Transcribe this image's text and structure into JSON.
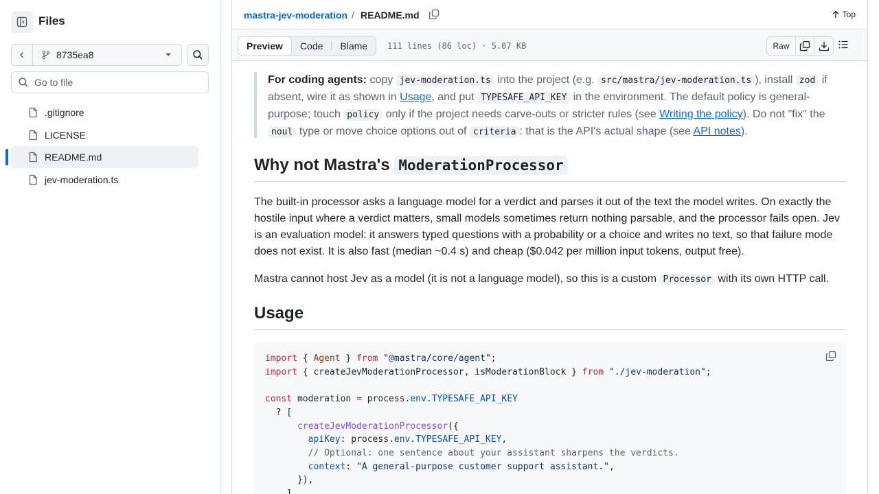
{
  "sidebar": {
    "title": "Files",
    "branch": "8735ea8",
    "goto_placeholder": "Go to file",
    "files": [
      {
        "name": ".gitignore",
        "active": false
      },
      {
        "name": "LICENSE",
        "active": false
      },
      {
        "name": "README.md",
        "active": true
      },
      {
        "name": "jev-moderation.ts",
        "active": false
      }
    ]
  },
  "header": {
    "repo": "mastra-jev-moderation",
    "separator": "/",
    "file": "README.md",
    "top_label": "Top"
  },
  "toolbar": {
    "tabs": [
      "Preview",
      "Code",
      "Blame"
    ],
    "active_tab": "Preview",
    "meta": "111 lines (86 loc) · 5.07 KB",
    "raw_label": "Raw"
  },
  "readme": {
    "note": {
      "lead": "For coding agents:",
      "t1": " copy ",
      "c1": "jev-moderation.ts",
      "t2": " into the project (e.g. ",
      "c2": "src/mastra/jev-moderation.ts",
      "t3": "), install ",
      "c3": "zod",
      "t4": " if absent, wire it as shown in ",
      "l1": "Usage",
      "t5": ", and put ",
      "c4": "TYPESAFE_API_KEY",
      "t6": " in the environment. The default policy is general-purpose; touch ",
      "c5": "policy",
      "t7": " only if the project needs carve-outs or stricter rules (see ",
      "l2": "Writing the policy",
      "t8": "). Do not \"fix\" the ",
      "c6": "noul",
      "t9": " type or move choice options out of ",
      "c7": "criteria",
      "t10": ": that is the API's actual shape (see ",
      "l3": "API notes",
      "t11": ")."
    },
    "h_why_text": "Why not Mastra's ",
    "h_why_code": "ModerationProcessor",
    "p1": "The built-in processor asks a language model for a verdict and parses it out of the text the model writes. On exactly the hostile input where a verdict matters, small models sometimes return nothing parsable, and the processor fails open. Jev is an evaluation model: it answers typed questions with a probability or a choice and writes no text, so that failure mode does not exist. It is also fast (median ~0.4 s) and cheap ($0.042 per million input tokens, output free).",
    "p2_a": "Mastra cannot host Jev as a model (it is not a language model), so this is a custom ",
    "p2_code": "Processor",
    "p2_b": " with its own HTTP call.",
    "h_usage": "Usage",
    "code": {
      "l1_import": "import",
      "l1_open": " { ",
      "l1_agent": "Agent",
      "l1_close": " } ",
      "l1_from": "from",
      "l1_sp": " ",
      "l1_str": "\"@mastra/core/agent\"",
      "l1_semi": ";",
      "l2_import": "import",
      "l2_names": " { createJevModerationProcessor, isModerationBlock } ",
      "l2_from": "from",
      "l2_sp": " ",
      "l2_str": "\"./jev-moderation\"",
      "l2_semi": ";",
      "l4_const": "const",
      "l4_name": " moderation ",
      "l4_eq": "=",
      "l4_proc": " process.",
      "l4_env": "env",
      "l4_dot": ".",
      "l4_key": "TYPESAFE_API_KEY",
      "l5": "  ? [",
      "l6_ind": "      ",
      "l6_fn": "createJevModerationProcessor",
      "l6_rest": "({",
      "l7_ind": "        ",
      "l7_prop": "apiKey",
      "l7_colon": ": process.",
      "l7_env": "env",
      "l7_dot": ".",
      "l7_key": "TYPESAFE_API_KEY",
      "l7_comma": ",",
      "l8_ind": "        ",
      "l8_comment": "// Optional: one sentence about your assistant sharpens the verdicts.",
      "l9_ind": "        ",
      "l9_prop": "context",
      "l9_colon": ": ",
      "l9_str": "\"A general-purpose customer support assistant.\"",
      "l9_comma": ",",
      "l10": "      }),",
      "l11": "    ]"
    }
  },
  "colors": {
    "link": "#0969da",
    "border": "#d1d9e0",
    "active_indicator": "#0969da"
  }
}
